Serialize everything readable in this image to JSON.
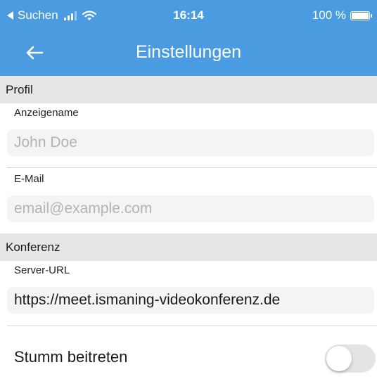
{
  "status_bar": {
    "back_app": "Suchen",
    "time": "16:14",
    "battery": "100 %",
    "battery_level": 1.0,
    "signal_icon": "cellular-signal-icon",
    "wifi_icon": "wifi-icon"
  },
  "nav": {
    "title": "Einstellungen",
    "back_icon": "arrow-left-icon"
  },
  "sections": {
    "profile": {
      "title": "Profil",
      "display_name_label": "Anzeigename",
      "display_name_placeholder": "John Doe",
      "email_label": "E-Mail",
      "email_placeholder": "email@example.com"
    },
    "conference": {
      "title": "Konferenz",
      "server_url_label": "Server-URL",
      "server_url_value": "https://meet.ismaning-videokonferenz.de",
      "mute_label": "Stumm beitreten",
      "mute_enabled": false
    }
  },
  "colors": {
    "header": "#4a9be0",
    "section_bg": "#e6e6e6",
    "toggle_off": "#e4e4e4"
  }
}
